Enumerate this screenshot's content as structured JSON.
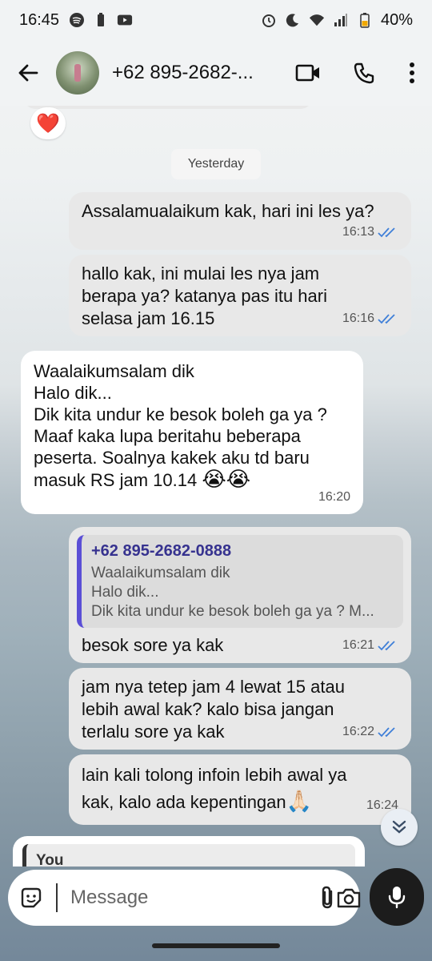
{
  "status_bar": {
    "time": "16:45",
    "battery": "40%"
  },
  "header": {
    "contact_name": "+62 895-2682-..."
  },
  "chat": {
    "reaction": "❤️",
    "date_chip": "Yesterday",
    "messages": [
      {
        "lines": [
          "Assalamualaikum kak, hari ini les ya?"
        ],
        "time": "16:13"
      },
      {
        "lines": [
          "hallo kak, ini mulai les nya jam",
          "berapa ya? katanya pas itu hari",
          "selasa jam 16.15"
        ],
        "time": "16:16"
      },
      {
        "lines": [
          "Waalaikumsalam dik",
          "Halo dik...",
          "Dik kita undur ke besok boleh ga ya ?",
          "Maaf kaka lupa beritahu beberapa",
          "peserta. Soalnya kakek aku td baru",
          "masuk RS jam 10.14"
        ],
        "emoji": "😭😭",
        "time": "16:20"
      },
      {
        "quote": {
          "name": "+62 895-2682-0888",
          "lines": [
            "Waalaikumsalam dik",
            "Halo dik...",
            "Dik kita undur ke besok boleh ga ya ? M..."
          ]
        },
        "lines": [
          "besok sore ya kak"
        ],
        "time": "16:21"
      },
      {
        "lines": [
          "jam nya tetep jam 4 lewat 15 atau",
          "lebih awal kak? kalo bisa jangan",
          "terlalu sore ya kak"
        ],
        "time": "16:22"
      },
      {
        "lines": [
          "lain kali tolong infoin lebih awal ya",
          "kak, kalo ada kepentingan"
        ],
        "emoji": "🙏🏻",
        "time": "16:24"
      }
    ],
    "partial_reply_name": "You"
  },
  "input": {
    "placeholder": "Message"
  },
  "colors": {
    "read_ticks": "#3f7fd8",
    "quote_bar": "#5b4fd6",
    "mic_button": "#1c1c1c"
  }
}
